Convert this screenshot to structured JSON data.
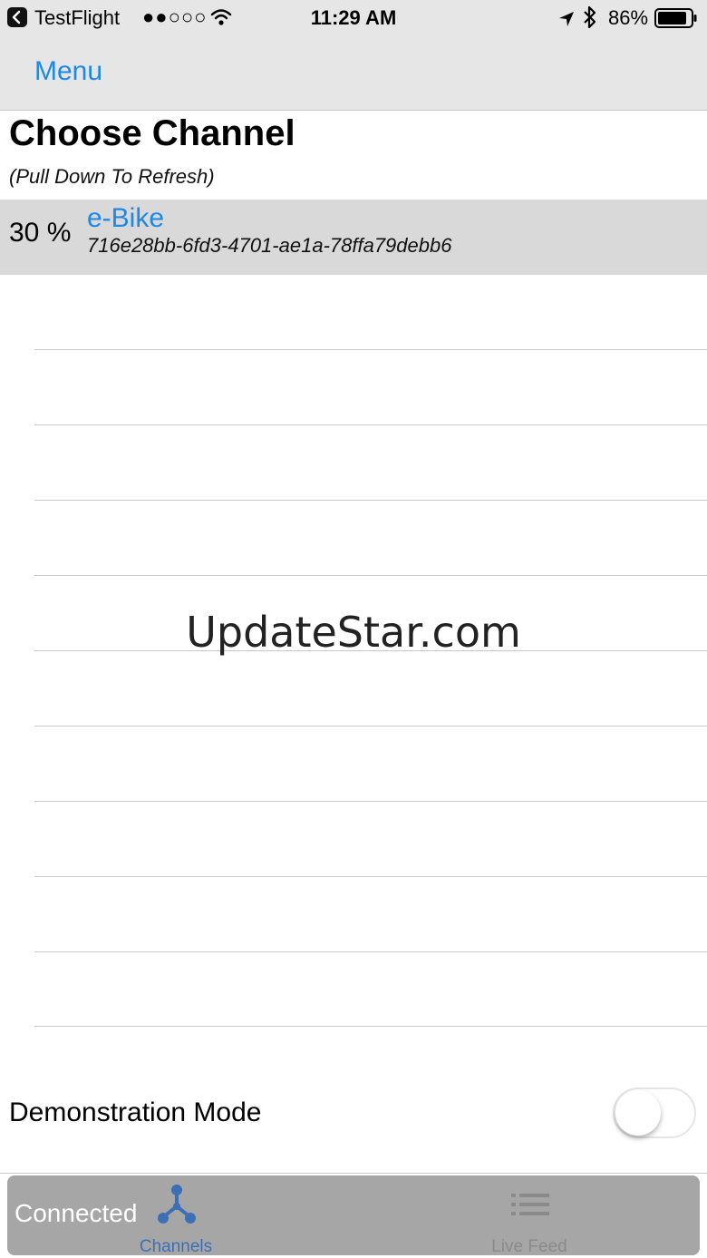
{
  "status_bar": {
    "app": "TestFlight",
    "signal": "●●○○○",
    "time": "11:29 AM",
    "battery": "86%"
  },
  "nav": {
    "menu_label": "Menu"
  },
  "page": {
    "title": "Choose Channel",
    "subtitle": "(Pull Down To Refresh)"
  },
  "channels": [
    {
      "percent": "30 %",
      "name": "e-Bike",
      "id": "716e28bb-6fd3-4701-ae1a-78ffa79debb6"
    }
  ],
  "watermark": "UpdateStar.com",
  "demo": {
    "label": "Demonstration Mode",
    "enabled": false
  },
  "tab_bar": {
    "status": "Connected",
    "tabs": [
      {
        "label": "Channels",
        "icon": "channels-icon",
        "selected": true
      },
      {
        "label": "Live Feed",
        "icon": "list-icon",
        "selected": false
      }
    ]
  },
  "colors": {
    "accent": "#1e88e5",
    "selected_tab": "#3d6fb5",
    "bar_bg": "#e6e6e6"
  }
}
